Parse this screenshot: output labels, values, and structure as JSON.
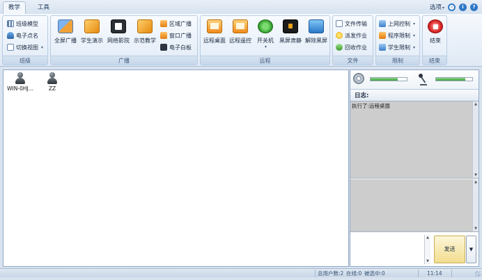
{
  "tabs": [
    {
      "label": "教学",
      "active": true
    },
    {
      "label": "工具",
      "active": false
    }
  ],
  "top_right": {
    "options_label": "选项",
    "minimize_icon": "minimize-circle-icon",
    "info_icon": "info-icon",
    "help_icon": "help-icon"
  },
  "ribbon": {
    "class_group": {
      "label": "班级",
      "items": [
        {
          "label": "班级模型",
          "icon": "class-model-icon"
        },
        {
          "label": "电子点名",
          "icon": "roll-call-icon"
        },
        {
          "label": "切换视图",
          "icon": "switch-view-icon",
          "dropdown": true
        }
      ]
    },
    "broadcast_group": {
      "label": "广播",
      "big_buttons": [
        {
          "label": "全屏广播",
          "icon": "fullscreen-broadcast-icon"
        },
        {
          "label": "学生演示",
          "icon": "student-demo-icon"
        },
        {
          "label": "网络影院",
          "icon": "network-cinema-icon"
        },
        {
          "label": "示范教学",
          "icon": "demo-teaching-icon"
        }
      ],
      "small_buttons": [
        {
          "label": "区域广播",
          "icon": "area-broadcast-icon"
        },
        {
          "label": "窗口广播",
          "icon": "window-broadcast-icon"
        },
        {
          "label": "电子白板",
          "icon": "whiteboard-icon"
        }
      ]
    },
    "remote_group": {
      "label": "远程",
      "big_buttons": [
        {
          "label": "远程桌面",
          "icon": "remote-desktop-icon"
        },
        {
          "label": "远程遥控",
          "icon": "remote-control-icon"
        },
        {
          "label": "开关机",
          "icon": "power-icon",
          "dropdown": true
        },
        {
          "label": "黑屏肃静",
          "icon": "black-screen-icon"
        },
        {
          "label": "解除黑屏",
          "icon": "unlock-screen-icon"
        }
      ]
    },
    "file_group": {
      "label": "文件",
      "items": [
        {
          "label": "文件传输",
          "icon": "file-transfer-icon"
        },
        {
          "label": "派发作业",
          "icon": "assign-homework-icon"
        },
        {
          "label": "回收作业",
          "icon": "collect-homework-icon"
        }
      ]
    },
    "limit_group": {
      "label": "限制",
      "items": [
        {
          "label": "上网控制",
          "icon": "internet-control-icon",
          "dropdown": true
        },
        {
          "label": "程序限制",
          "icon": "program-limit-icon",
          "dropdown": true
        },
        {
          "label": "学生限制",
          "icon": "student-limit-icon",
          "dropdown": true
        }
      ]
    },
    "end_group": {
      "label": "结束",
      "button": {
        "label": "结束",
        "icon": "stop-icon"
      }
    }
  },
  "students": [
    {
      "name": "WIN-0HJ...",
      "icon": "student-user-icon"
    },
    {
      "name": "ZZ",
      "icon": "student-user-icon"
    }
  ],
  "audio": {
    "speaker_icon": "speaker-icon",
    "mic_icon": "microphone-icon",
    "speaker_level": 0.75,
    "mic_level": 0.8
  },
  "log": {
    "header": "日志:",
    "entries": [
      "执行了:远程桌面"
    ]
  },
  "chat": {
    "send_label": "发送",
    "dropdown_glyph": "▼"
  },
  "statusbar": {
    "total_users": "总用户数:2",
    "online": "在线:0",
    "selected": "被选中:0",
    "time": "11:14"
  }
}
